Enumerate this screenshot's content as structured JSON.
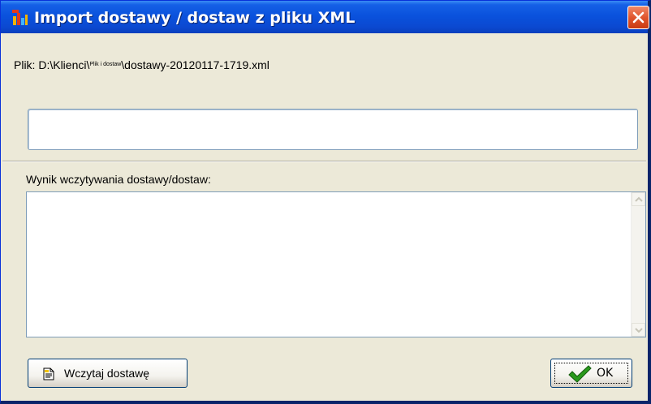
{
  "window": {
    "title": "Import dostawy / dostaw z pliku XML"
  },
  "file": {
    "prefix": "Plik: D:\\Klienci\\",
    "small_segment": "Plik i dostaw",
    "suffix": "\\dostawy-20120117-1719.xml"
  },
  "input": {
    "value": ""
  },
  "result": {
    "label": "Wynik wczytywania dostawy/dostaw:",
    "text": ""
  },
  "buttons": {
    "load_label": "Wczytaj dostawę",
    "ok_label": "OK"
  },
  "colors": {
    "titlebar": "#0a52dd",
    "dialog_bg": "#ece9d8",
    "close": "#e0552e",
    "ok_check": "#2a9a1c"
  },
  "icons": {
    "app": "app-icon",
    "close": "close-icon",
    "load": "document-icon",
    "ok": "checkmark-icon"
  }
}
